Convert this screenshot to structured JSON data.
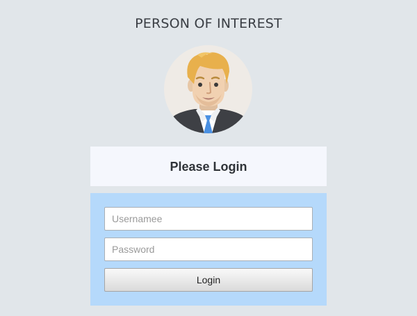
{
  "app": {
    "title": "PERSON OF INTEREST"
  },
  "avatar": {
    "icon": "user-avatar-icon"
  },
  "login": {
    "heading": "Please Login",
    "username_placeholder": "Usernamee",
    "username_value": "",
    "password_placeholder": "Password",
    "password_value": "",
    "button_label": "Login"
  },
  "colors": {
    "page_background": "#e1e6ea",
    "header_card_background": "#f5f7fd",
    "form_card_background": "#b5d9fb",
    "title_text": "#3a3e44"
  }
}
